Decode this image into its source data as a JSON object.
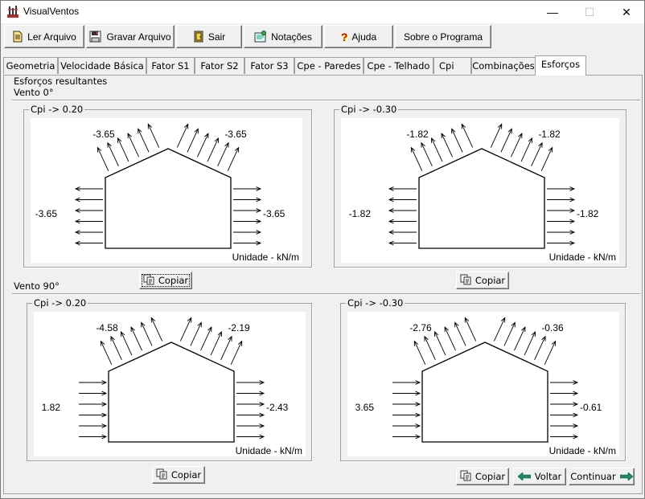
{
  "window": {
    "title": "VisualVentos",
    "minimize": "—",
    "maximize": "☐",
    "close": "✕"
  },
  "toolbar": {
    "ler_arquivo": "Ler Arquivo",
    "gravar_arquivo": "Gravar Arquivo",
    "sair": "Sair",
    "notacoes": "Notações",
    "ajuda": "Ajuda",
    "sobre": "Sobre o Programa"
  },
  "tabs": [
    {
      "label": "Geometria"
    },
    {
      "label": "Velocidade Básica"
    },
    {
      "label": "Fator S1"
    },
    {
      "label": "Fator S2"
    },
    {
      "label": "Fator S3"
    },
    {
      "label": "Cpe - Paredes"
    },
    {
      "label": "Cpe - Telhado"
    },
    {
      "label": "Cpi"
    },
    {
      "label": "Combinações"
    },
    {
      "label": "Esforços"
    }
  ],
  "panel": {
    "title": "Esforços resultantes",
    "vento0_label": "Vento 0°",
    "vento90_label": "Vento 90°",
    "unit_label": "Unidade - kN/m",
    "copy_label": "Copiar",
    "back_label": "Voltar",
    "continue_label": "Continuar"
  },
  "diagrams": [
    {
      "group_label": "Cpi -> 0.20",
      "roof_left": "-3.65",
      "roof_right": "-3.65",
      "wall_left": "-3.65",
      "wall_right": "-3.65",
      "wall_left_dir": "out",
      "wall_right_dir": "out"
    },
    {
      "group_label": "Cpi -> -0.30",
      "roof_left": "-1.82",
      "roof_right": "-1.82",
      "wall_left": "-1.82",
      "wall_right": "-1.82",
      "wall_left_dir": "out",
      "wall_right_dir": "out"
    },
    {
      "group_label": "Cpi -> 0.20",
      "roof_left": "-4.58",
      "roof_right": "-2.19",
      "wall_left": "1.82",
      "wall_right": "-2.43",
      "wall_left_dir": "in",
      "wall_right_dir": "out"
    },
    {
      "group_label": "Cpi -> -0.30",
      "roof_left": "-2.76",
      "roof_right": "-0.36",
      "wall_left": "3.65",
      "wall_right": "-0.61",
      "wall_left_dir": "in",
      "wall_right_dir": "out"
    }
  ]
}
